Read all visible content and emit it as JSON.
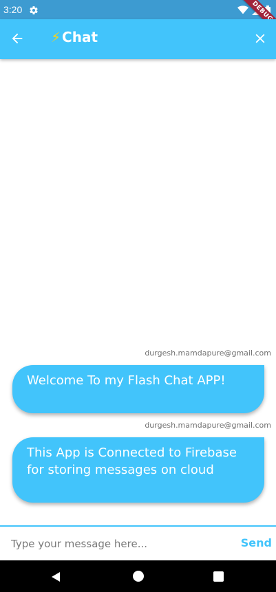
{
  "status_bar": {
    "time": "3:20",
    "debug_label": "DEBUG"
  },
  "app_bar": {
    "title": "Chat",
    "bolt_glyph": "⚡",
    "back_icon": "arrow-back-icon",
    "close_icon": "close-icon",
    "background": "#42c4fb"
  },
  "messages": [
    {
      "sender": "durgesh.mamdapure@gmail.com",
      "text": "Welcome To my Flash Chat APP!"
    },
    {
      "sender": "durgesh.mamdapure@gmail.com",
      "text": "This App is Connected to Firebase for storing messages on cloud"
    }
  ],
  "composer": {
    "placeholder": "Type your message here...",
    "value": "",
    "send_label": "Send"
  },
  "colors": {
    "accent": "#42c4fb",
    "status_bar": "#3d9bd1"
  }
}
